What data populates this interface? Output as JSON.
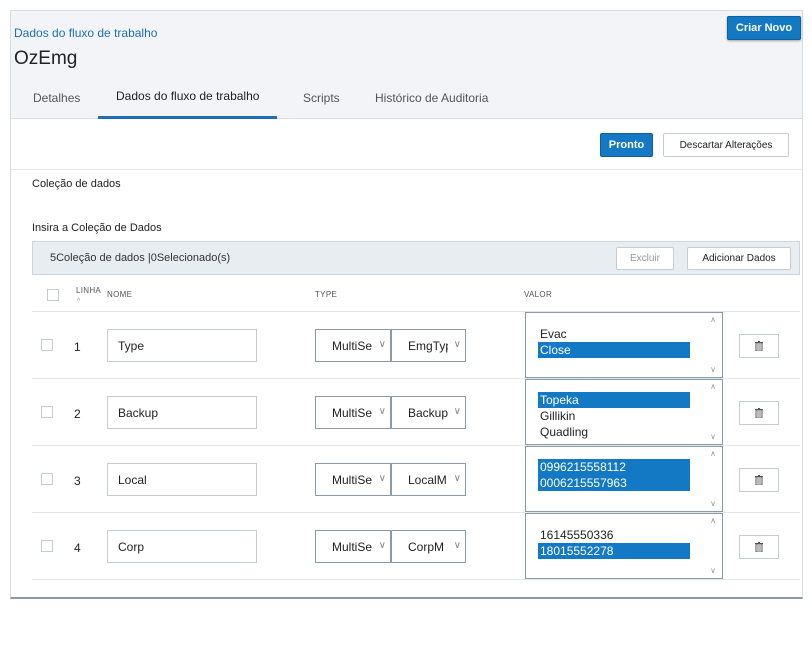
{
  "header": {
    "breadcrumb": "Dados do fluxo de trabalho",
    "title": "OzEmg",
    "create_button": "Criar Novo"
  },
  "tabs": [
    {
      "label": "Detalhes",
      "active": false
    },
    {
      "label": "Dados do fluxo de trabalho",
      "active": true
    },
    {
      "label": "Scripts",
      "active": false
    },
    {
      "label": "Histórico de Auditoria",
      "active": false
    }
  ],
  "toolbar": {
    "done_button": "Pronto",
    "discard_button": "Descartar Alterações"
  },
  "section": {
    "title": "Coleção de dados",
    "subtitle": "Insira a Coleção de Dados"
  },
  "collection_bar": {
    "count_text": "5Coleção de dados |0Selecionado(s)",
    "delete_button": "Excluir",
    "add_button": "Adicionar Dados"
  },
  "table": {
    "headers": {
      "line": "LINHA",
      "name": "NOME",
      "type": "TYPE",
      "value": "VALOR"
    },
    "rows": [
      {
        "num": "1",
        "name": "Type",
        "type": "MultiSe",
        "subtype": "EmgTyp",
        "values": [
          {
            "text": "Evac",
            "selected": false
          },
          {
            "text": "Close",
            "selected": true
          }
        ]
      },
      {
        "num": "2",
        "name": "Backup",
        "type": "MultiSe",
        "subtype": "Backup",
        "values": [
          {
            "text": "Topeka",
            "selected": true
          },
          {
            "text": "Gillikin",
            "selected": false
          },
          {
            "text": "Quadling",
            "selected": false
          }
        ]
      },
      {
        "num": "3",
        "name": "Local",
        "type": "MultiSe",
        "subtype": "LocalM",
        "values": [
          {
            "text": "0996215558112",
            "selected": true
          },
          {
            "text": "0006215557963",
            "selected": true
          }
        ]
      },
      {
        "num": "4",
        "name": "Corp",
        "type": "MultiSe",
        "subtype": "CorpM",
        "values": [
          {
            "text": "16145550336",
            "selected": false
          },
          {
            "text": "18015552278",
            "selected": true
          }
        ]
      }
    ]
  },
  "icons": {
    "trash": "trash-icon",
    "chevron": "chevron-down-icon",
    "scroll_up": "scroll-up-icon",
    "scroll_down": "scroll-down-icon"
  },
  "colors": {
    "accent": "#1379c4",
    "link": "#1f6fb4",
    "header_bg": "#f2f4f7"
  }
}
